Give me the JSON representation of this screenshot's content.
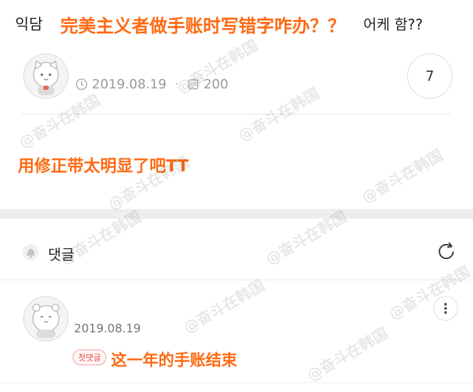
{
  "post": {
    "title_prefix": "익담",
    "title_suffix": "어케 함??",
    "title_overlay": "完美主义者做手账时写错字咋办？？",
    "date": "2019.08.19",
    "views": "200",
    "comment_count": "7",
    "body_overlay": "用修正带太明显了吧TT"
  },
  "comments": {
    "header_label": "댓글",
    "items": [
      {
        "date": "2019.08.19",
        "badge": "첫댓글",
        "text_overlay": "这一年的手账结束"
      }
    ]
  },
  "watermark": "@奋斗在韩国",
  "colors": {
    "overlay_text": "#ff6a13",
    "meta_text": "#9a9a9a",
    "badge": "#e24b4b",
    "section_gap": "#eeeeee"
  },
  "icons": [
    "clock-icon",
    "eye-icon",
    "bell-icon",
    "refresh-icon",
    "more-vertical-icon"
  ]
}
